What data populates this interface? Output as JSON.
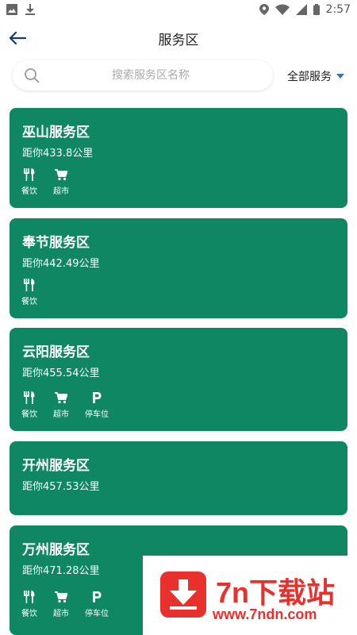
{
  "status_bar": {
    "time": "2:57"
  },
  "header": {
    "title": "服务区"
  },
  "search": {
    "placeholder": "搜索服务区名称",
    "filter_label": "全部服务"
  },
  "cards": [
    {
      "name": "巫山服务区",
      "distance": "距你433.8公里",
      "services": [
        {
          "icon": "restaurant-icon",
          "label": "餐饮"
        },
        {
          "icon": "cart-icon",
          "label": "超市"
        }
      ]
    },
    {
      "name": "奉节服务区",
      "distance": "距你442.49公里",
      "services": [
        {
          "icon": "restaurant-icon",
          "label": "餐饮"
        }
      ]
    },
    {
      "name": "云阳服务区",
      "distance": "距你455.54公里",
      "services": [
        {
          "icon": "restaurant-icon",
          "label": "餐饮"
        },
        {
          "icon": "cart-icon",
          "label": "超市"
        },
        {
          "icon": "parking-icon",
          "label": "停车位"
        }
      ]
    },
    {
      "name": "开州服务区",
      "distance": "距你457.53公里",
      "services": []
    },
    {
      "name": "万州服务区",
      "distance": "距你471.28公里",
      "services": [
        {
          "icon": "restaurant-icon",
          "label": "餐饮"
        },
        {
          "icon": "cart-icon",
          "label": "超市"
        },
        {
          "icon": "parking-icon",
          "label": "停车位"
        }
      ]
    }
  ],
  "watermark": {
    "title": "7n下载站",
    "url": "www.7ndn.com"
  },
  "colors": {
    "card_bg": "#108763",
    "accent": "#2d6fd6",
    "watermark": "#e8302d"
  }
}
